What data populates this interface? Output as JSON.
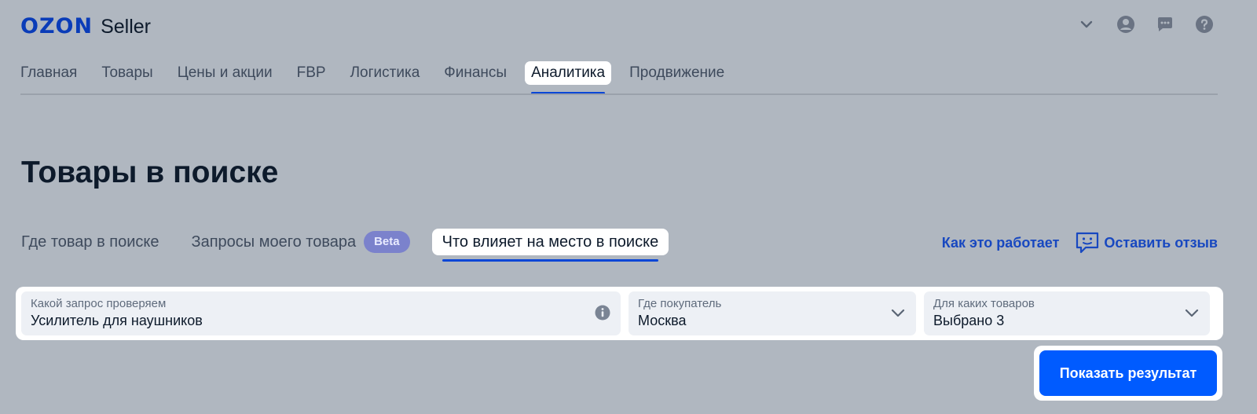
{
  "header": {
    "logo_text": "OZON",
    "logo_sub": "Seller",
    "icons": [
      "chevron-down-icon",
      "account-icon",
      "chat-icon",
      "help-icon"
    ]
  },
  "nav": {
    "items": [
      {
        "label": "Главная"
      },
      {
        "label": "Товары"
      },
      {
        "label": "Цены и акции"
      },
      {
        "label": "FBP"
      },
      {
        "label": "Логистика"
      },
      {
        "label": "Финансы"
      },
      {
        "label": "Аналитика",
        "active": true
      },
      {
        "label": "Продвижение"
      }
    ]
  },
  "page": {
    "title": "Товары в поиске"
  },
  "subtabs": {
    "items": [
      {
        "label": "Где товар в поиске"
      },
      {
        "label": "Запросы моего товара",
        "badge": "Beta"
      },
      {
        "label": "Что влияет на место в поиске",
        "active": true
      }
    ]
  },
  "links": {
    "how_it_works": "Как это работает",
    "feedback": "Оставить отзыв"
  },
  "filters": {
    "query": {
      "label": "Какой запрос проверяем",
      "value": "Усилитель для наушников",
      "icon": "info-icon"
    },
    "location": {
      "label": "Где покупатель",
      "value": "Москва",
      "icon": "chevron-down-icon"
    },
    "products": {
      "label": "Для каких товаров",
      "value": "Выбрано 3",
      "icon": "chevron-down-icon"
    }
  },
  "actions": {
    "submit_label": "Показать результат"
  },
  "colors": {
    "background": "#b0b7c0",
    "brand": "#0a3cb8",
    "primary_button": "#005bff",
    "link": "#1848c0",
    "beta_badge": "#7b82cc"
  }
}
